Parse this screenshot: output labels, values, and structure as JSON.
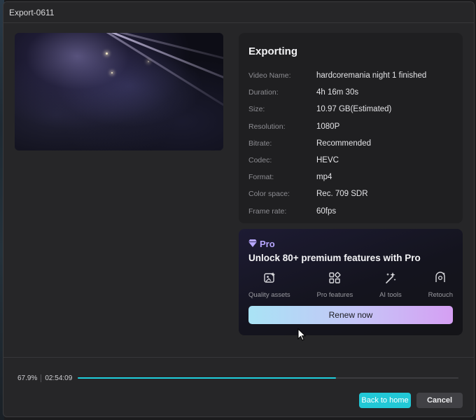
{
  "window": {
    "title": "Export-0611"
  },
  "info": {
    "heading": "Exporting",
    "rows": [
      {
        "key": "Video Name:",
        "value": "hardcoremania night 1 finished"
      },
      {
        "key": "Duration:",
        "value": "4h 16m 30s"
      },
      {
        "key": "Size:",
        "value": "10.97 GB(Estimated)"
      },
      {
        "key": "Resolution:",
        "value": "1080P"
      },
      {
        "key": "Bitrate:",
        "value": "Recommended"
      },
      {
        "key": "Codec:",
        "value": "HEVC"
      },
      {
        "key": "Format:",
        "value": "mp4"
      },
      {
        "key": "Color space:",
        "value": "Rec. 709 SDR"
      },
      {
        "key": "Frame rate:",
        "value": "60fps"
      }
    ]
  },
  "pro": {
    "tag": "Pro",
    "title": "Unlock 80+ premium features with Pro",
    "features": [
      {
        "label": "Quality assets",
        "icon": "image-sparkle-icon"
      },
      {
        "label": "Pro features",
        "icon": "grid-icon"
      },
      {
        "label": "AI tools",
        "icon": "magic-wand-icon"
      },
      {
        "label": "Retouch",
        "icon": "retouch-icon"
      }
    ],
    "renew_label": "Renew now",
    "accent_color": "#b7a7ff"
  },
  "progress": {
    "percent_label": "67.9%",
    "percent_value": 0.679,
    "time_remaining": "02:54:09",
    "bar_color": "#1fd0dd"
  },
  "footer": {
    "back_label": "Back to home",
    "cancel_label": "Cancel"
  }
}
